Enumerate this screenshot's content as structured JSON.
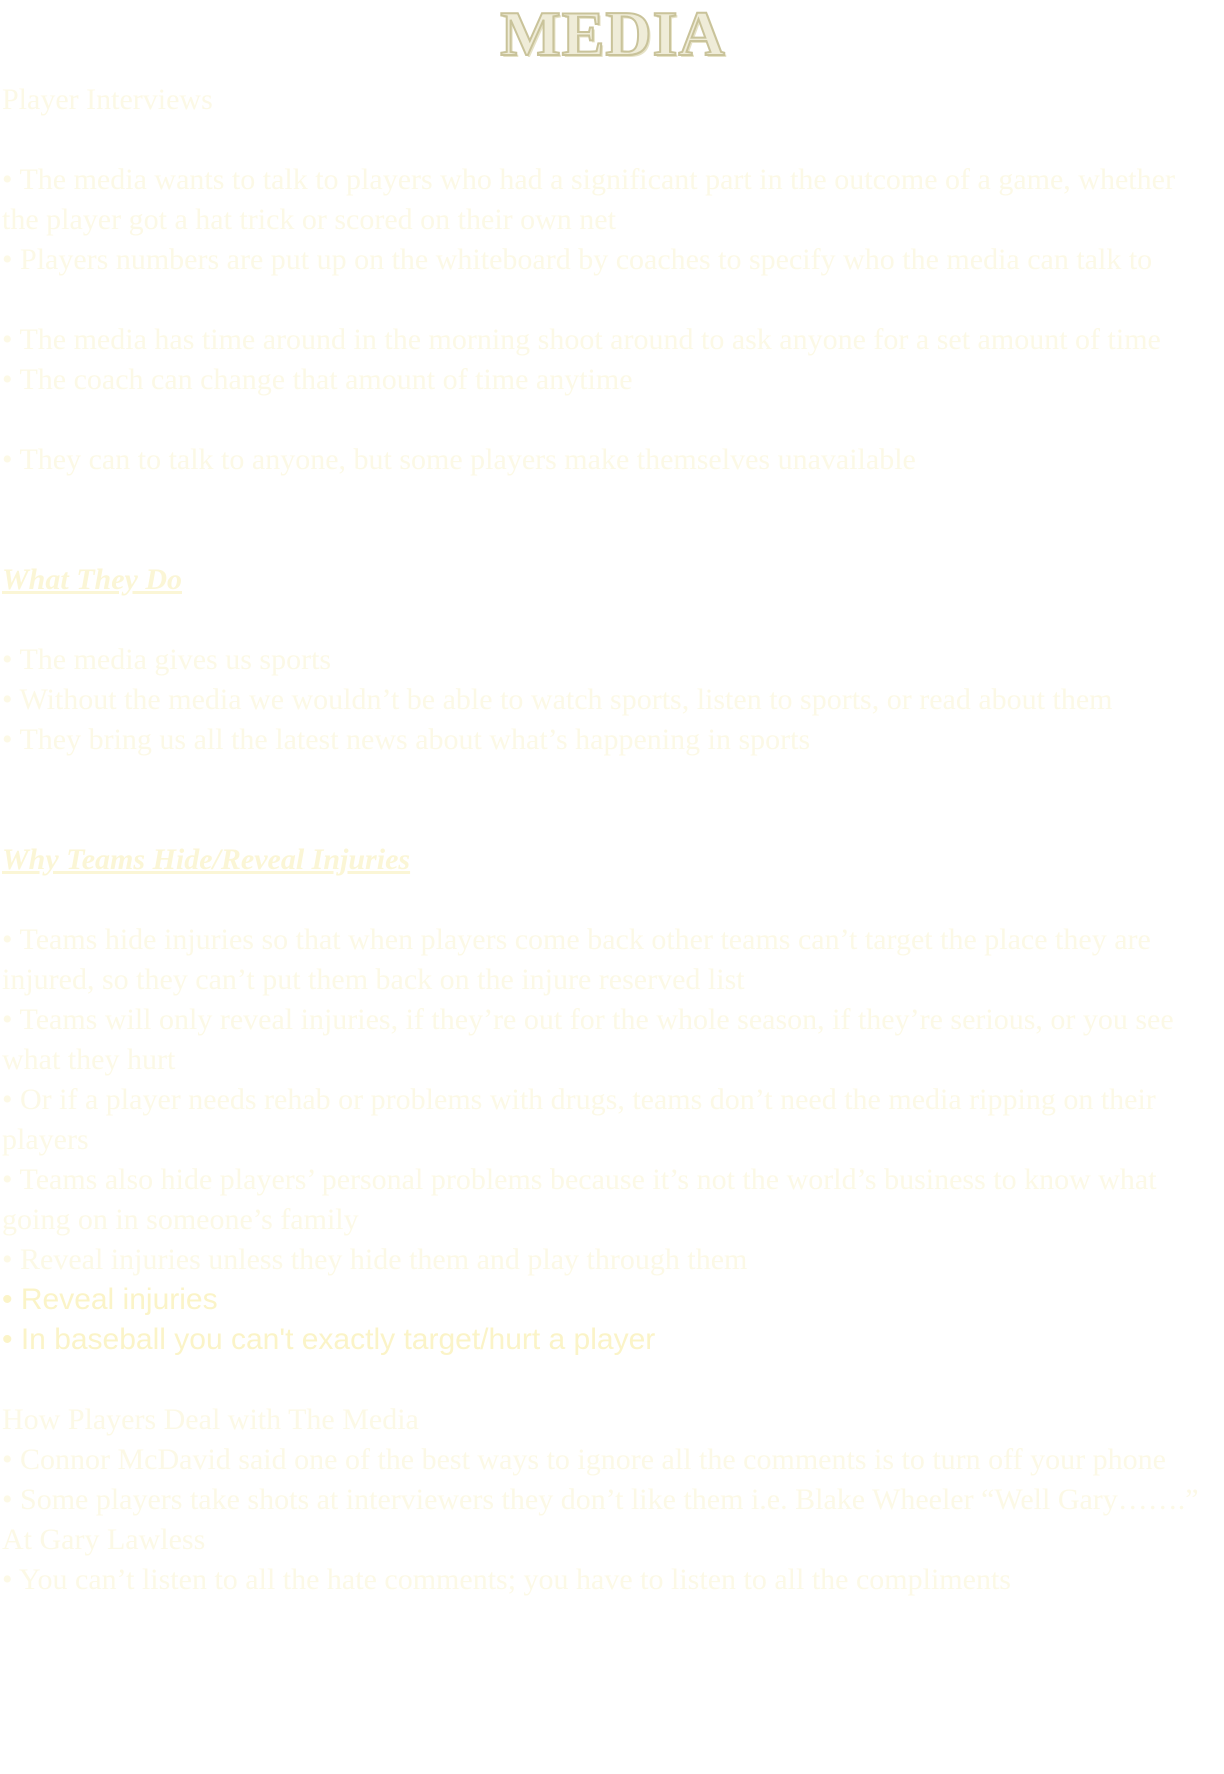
{
  "title": "MEDIA",
  "section1": {
    "heading": "Player Interviews",
    "bullets_a": [
      "• The media wants to talk to players who had a significant part in the outcome of a game, whether the player got a hat trick or scored on their own net",
      "• Players numbers are put up on the whiteboard by coaches to specify who the media can talk to"
    ],
    "bullets_b": [
      "• The media has time around in the morning shoot around to ask anyone for a set amount of time",
      "• The coach can change that amount of time anytime"
    ],
    "bullets_c": [
      "• They can to talk to anyone, but some players make themselves unavailable"
    ]
  },
  "section2": {
    "heading": "What They Do",
    "bullets": [
      "• The media gives us sports",
      "• Without the media we wouldn’t be able to watch sports, listen to sports, or read about them",
      "• They bring us all the latest news about what’s happening in sports"
    ]
  },
  "section3": {
    "heading": "Why Teams Hide/Reveal Injuries",
    "bullets": [
      "• Teams hide injuries so that when players come back other teams can’t target the place they are injured, so they can’t put them back on the injure reserved list",
      "• Teams will only reveal injuries, if they’re out for the whole season, if they’re serious, or you see what they hurt",
      "• Or if a player needs rehab or problems with drugs, teams don’t need the media ripping on their players",
      "• Teams also hide players’ personal problems because it’s not the world’s business to know what going on in someone’s family",
      "• Reveal injuries unless they hide them and play through them"
    ],
    "bullets_sans": [
      "• Reveal injuries",
      "• In baseball you can't exactly target/hurt a player"
    ]
  },
  "section4": {
    "heading": "How Players Deal with The Media",
    "bullets": [
      "• Connor McDavid said one of the best ways to ignore all the comments is to turn off your phone",
      "• Some players take shots at interviewers they don’t like them i.e. Blake Wheeler “Well Gary…….” At Gary Lawless",
      "• You can’t listen to all the hate comments; you have to listen to all the compliments"
    ]
  },
  "colors": {
    "text": "#fcf9e6",
    "title_fill": "#efecd8",
    "title_stroke": "#c9c39a"
  }
}
